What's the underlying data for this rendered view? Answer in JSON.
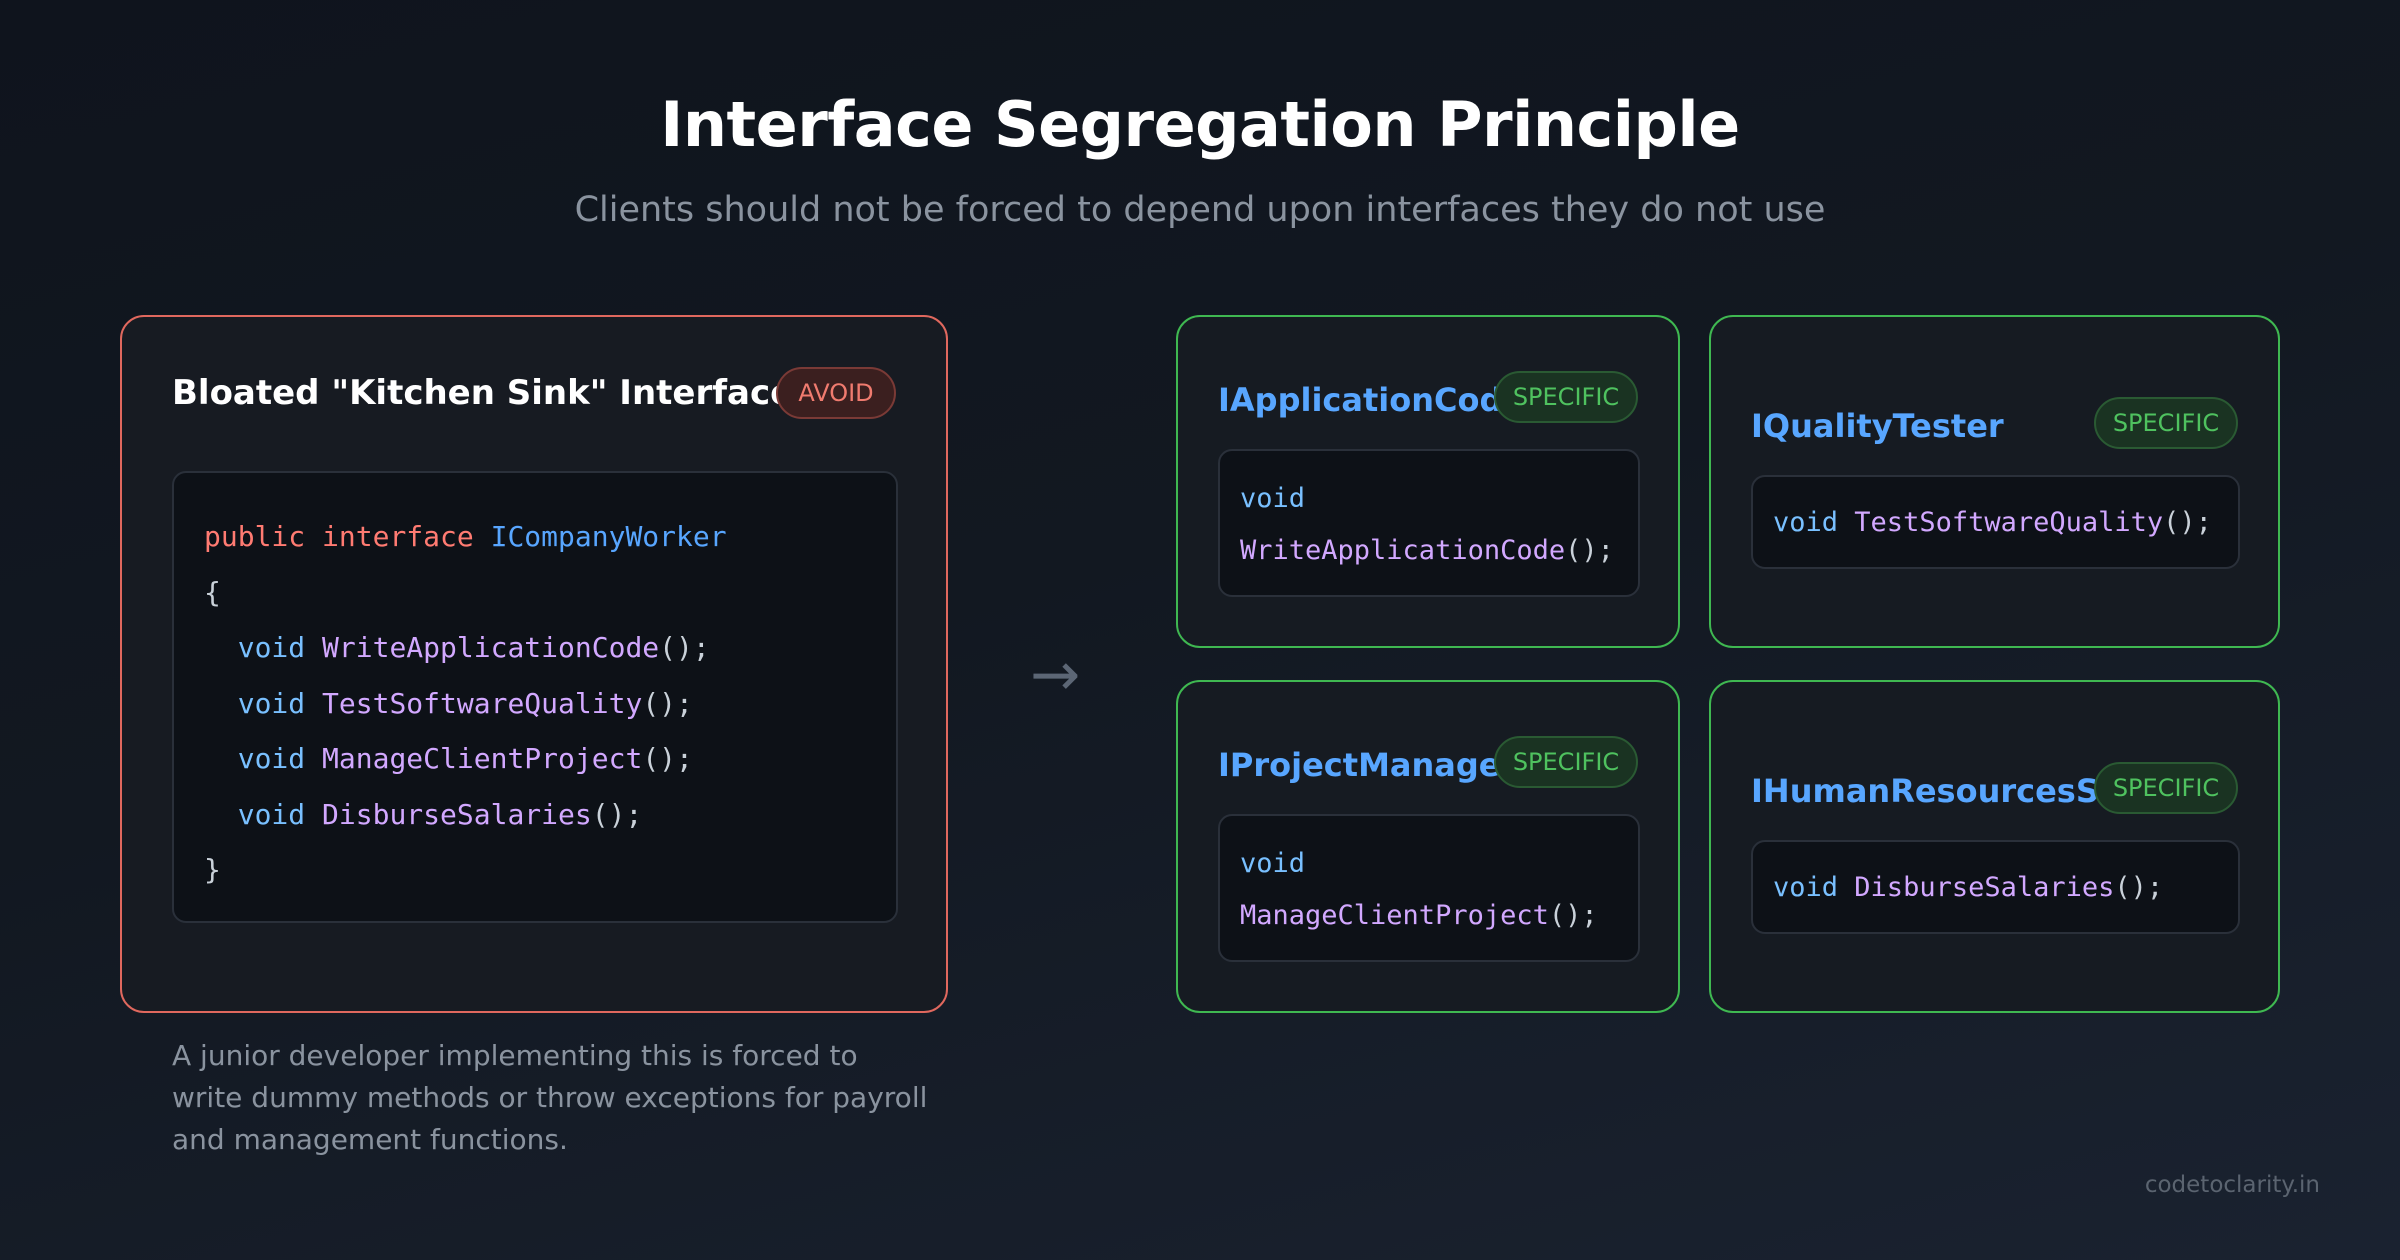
{
  "header": {
    "title": "Interface Segregation Principle",
    "subtitle": "Clients should not be forced to depend upon interfaces they do not use"
  },
  "bad_card": {
    "title": "Bloated \"Kitchen Sink\" Interface",
    "badge": "AVOID",
    "code": {
      "kw_public": "public",
      "kw_interface": "interface",
      "name": "ICompanyWorker",
      "open": "{",
      "close": "}",
      "methods": [
        {
          "ret": "void",
          "name": "WriteApplicationCode",
          "sig": "();"
        },
        {
          "ret": "void",
          "name": "TestSoftwareQuality",
          "sig": "();"
        },
        {
          "ret": "void",
          "name": "ManageClientProject",
          "sig": "();"
        },
        {
          "ret": "void",
          "name": "DisburseSalaries",
          "sig": "();"
        }
      ]
    },
    "caption": "A junior developer implementing this is forced to write dummy methods or throw exceptions for payroll and management functions."
  },
  "arrow": "→",
  "good_cards": [
    {
      "title": "IApplicationCoder",
      "badge": "SPECIFIC",
      "ret": "void",
      "method": "WriteApplicationCode",
      "sig": "();"
    },
    {
      "title": "IQualityTester",
      "badge": "SPECIFIC",
      "ret": "void",
      "method": "TestSoftwareQuality",
      "sig": "();"
    },
    {
      "title": "IProjectManager",
      "badge": "SPECIFIC",
      "ret": "void",
      "method": "ManageClientProject",
      "sig": "();"
    },
    {
      "title": "IHumanResourcesStaff",
      "badge": "SPECIFIC",
      "ret": "void",
      "method": "DisburseSalaries",
      "sig": "();"
    }
  ],
  "footer": {
    "watermark": "codetoclarity.in"
  },
  "colors": {
    "avoid": "#e0685e",
    "specific": "#3fb851",
    "keyword": "#ff7b72",
    "type": "#58a6ff",
    "method": "#d2a8ff"
  }
}
